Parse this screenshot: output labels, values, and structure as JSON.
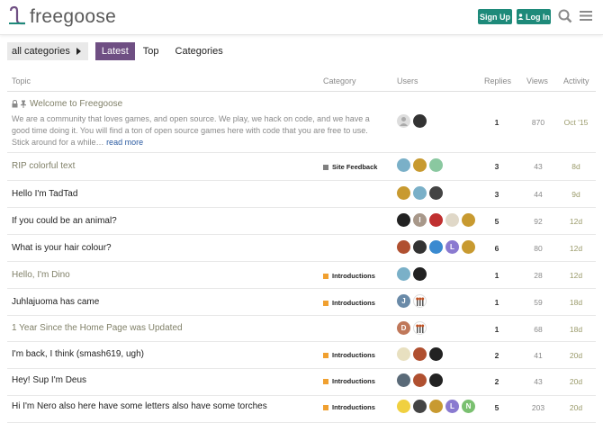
{
  "header": {
    "logo_text": "freegoose",
    "signup_label": "Sign Up",
    "login_label": "Log In",
    "login_icon": "user-icon",
    "search_icon": "search-icon",
    "menu_icon": "hamburger-icon"
  },
  "nav": {
    "category_dropdown": "all categories",
    "latest": "Latest",
    "top": "Top",
    "categories": "Categories"
  },
  "table": {
    "headers": {
      "topic": "Topic",
      "category": "Category",
      "users": "Users",
      "replies": "Replies",
      "views": "Views",
      "activity": "Activity"
    },
    "rows": [
      {
        "title": "Welcome to Freegoose",
        "excerpt": "We are a community that loves games, and open source. We play, we hack on code, and we have a good time doing it. You will find a ton of open source games here with code that you are free to use. Stick around for a while…",
        "read_more": "read more",
        "category": "",
        "replies": "1",
        "views": "870",
        "activity": "Oct '15"
      },
      {
        "title": "RIP colorful text",
        "category": "Site Feedback",
        "replies": "3",
        "views": "43",
        "activity": "8d"
      },
      {
        "title": "Hello I'm TadTad",
        "category": "",
        "replies": "3",
        "views": "44",
        "activity": "9d"
      },
      {
        "title": "If you could be an animal?",
        "category": "",
        "replies": "5",
        "views": "92",
        "activity": "12d"
      },
      {
        "title": "What is your hair colour?",
        "category": "",
        "replies": "6",
        "views": "80",
        "activity": "12d"
      },
      {
        "title": "Hello, I'm Dino",
        "category": "Introductions",
        "replies": "1",
        "views": "28",
        "activity": "12d"
      },
      {
        "title": "Juhlajuoma has came",
        "category": "Introductions",
        "replies": "1",
        "views": "59",
        "activity": "18d"
      },
      {
        "title": "1 Year Since the Home Page was Updated",
        "category": "",
        "replies": "1",
        "views": "68",
        "activity": "18d"
      },
      {
        "title": "I'm back, I think (smash619, ugh)",
        "category": "Introductions",
        "replies": "2",
        "views": "41",
        "activity": "20d"
      },
      {
        "title": "Hey! Sup I'm Deus",
        "category": "Introductions",
        "replies": "2",
        "views": "43",
        "activity": "20d"
      },
      {
        "title": "Hi I'm Nero also here have some letters also have some torches",
        "category": "Introductions",
        "replies": "5",
        "views": "203",
        "activity": "20d"
      }
    ]
  },
  "avatar_letters": {
    "row3_i": "I",
    "row4_l": "L",
    "row6_j": "J",
    "row7_d": "D",
    "row10_l": "L",
    "row10_n": "N"
  },
  "colors": {
    "accent": "#1e8a7a",
    "nav_active": "#6f4f83",
    "site_feedback": "#808080",
    "introductions": "#f0a030"
  }
}
